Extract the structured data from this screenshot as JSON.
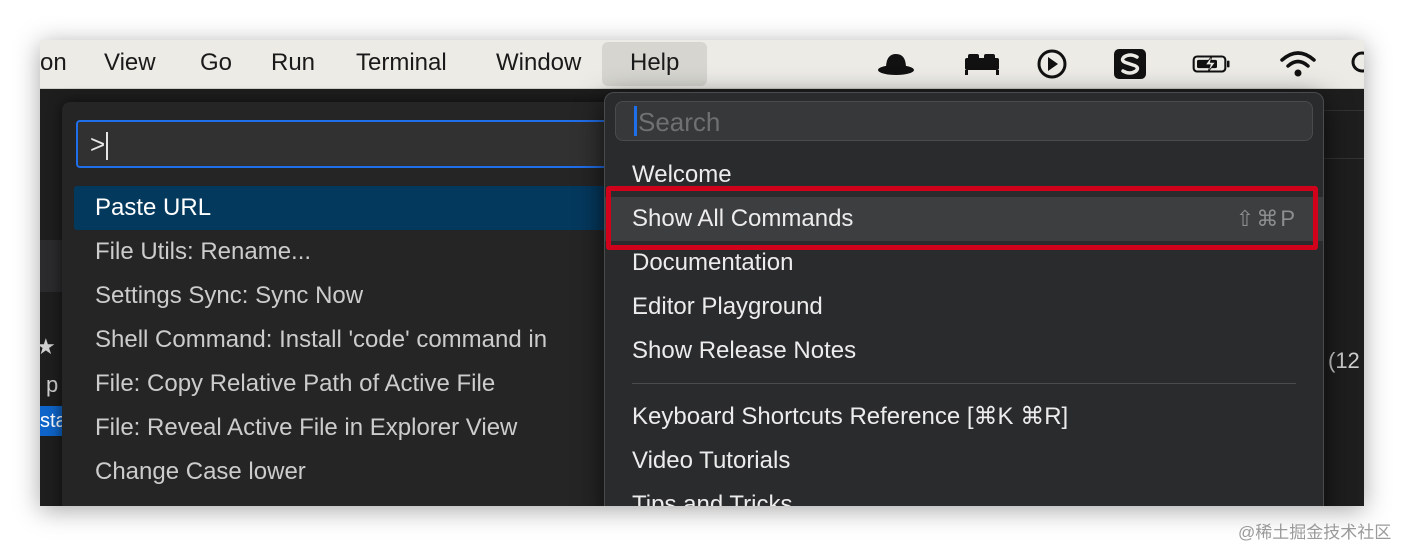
{
  "menubar": {
    "items": [
      {
        "label": "on"
      },
      {
        "label": "View"
      },
      {
        "label": "Go"
      },
      {
        "label": "Run"
      },
      {
        "label": "Terminal"
      },
      {
        "label": "Window"
      },
      {
        "label": "Help"
      }
    ],
    "tray_icons": [
      "incognito-hat-icon",
      "bed-icon",
      "play-circle-icon",
      "sogou-input-icon",
      "battery-charging-icon",
      "wifi-icon",
      "search-icon"
    ]
  },
  "background": {
    "right_text": "(12",
    "left_fragments": [
      "★",
      "p",
      "sta"
    ]
  },
  "palette": {
    "input_value": ">",
    "items": [
      {
        "label": "Paste URL"
      },
      {
        "label": "File Utils: Rename..."
      },
      {
        "label": "Settings Sync: Sync Now"
      },
      {
        "label": "Shell Command: Install 'code' command in"
      },
      {
        "label": "File: Copy Relative Path of Active File"
      },
      {
        "label": "File: Reveal Active File in Explorer View"
      },
      {
        "label": "Change Case lower"
      }
    ]
  },
  "help_menu": {
    "search_placeholder": "Search",
    "items": [
      {
        "label": "Welcome",
        "shortcut": ""
      },
      {
        "label": "Show All Commands",
        "shortcut": "⇧⌘P"
      },
      {
        "label": "Documentation",
        "shortcut": ""
      },
      {
        "label": "Editor Playground",
        "shortcut": ""
      },
      {
        "label": "Show Release Notes",
        "shortcut": ""
      },
      {
        "label": "Keyboard Shortcuts Reference [⌘K ⌘R]",
        "shortcut": ""
      },
      {
        "label": "Video Tutorials",
        "shortcut": ""
      },
      {
        "label": "Tips and Tricks",
        "shortcut": ""
      }
    ]
  },
  "highlight_color": "#d0021b",
  "watermark": "@稀土掘金技术社区"
}
